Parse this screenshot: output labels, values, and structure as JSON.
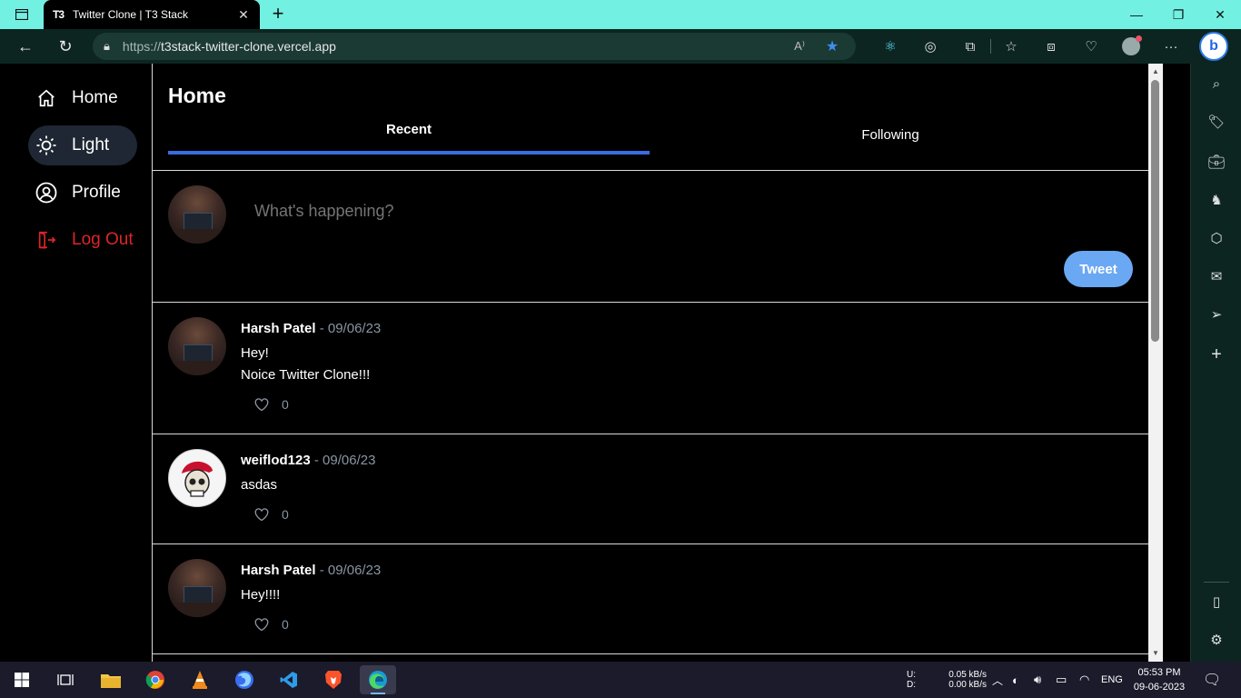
{
  "browser": {
    "tab_favicon": "T3",
    "tab_title": "Twitter Clone | T3 Stack",
    "url_prefix": "https://",
    "url_host": "t3stack-twitter-clone.vercel.app"
  },
  "nav": {
    "items": [
      {
        "label": "Home",
        "icon": "home-icon"
      },
      {
        "label": "Light",
        "icon": "sun-icon"
      },
      {
        "label": "Profile",
        "icon": "user-circle-icon"
      },
      {
        "label": "Log Out",
        "icon": "logout-icon"
      }
    ]
  },
  "main": {
    "title": "Home",
    "tabs": [
      {
        "label": "Recent",
        "active": true
      },
      {
        "label": "Following",
        "active": false
      }
    ],
    "compose": {
      "placeholder": "What's happening?",
      "button": "Tweet"
    },
    "posts": [
      {
        "author": "Harsh Patel",
        "date": " - 09/06/23",
        "lines": [
          "Hey!",
          "Noice Twitter Clone!!!"
        ],
        "likes": "0",
        "avatar": "desk"
      },
      {
        "author": "weiflod123",
        "date": " - 09/06/23",
        "lines": [
          "asdas"
        ],
        "likes": "0",
        "avatar": "skull"
      },
      {
        "author": "Harsh Patel",
        "date": " - 09/06/23",
        "lines": [
          "Hey!!!!"
        ],
        "likes": "0",
        "avatar": "desk"
      }
    ]
  },
  "taskbar": {
    "net_up_label": "U:",
    "net_down_label": "D:",
    "net_up": "0.05 kB/s",
    "net_down": "0.00 kB/s",
    "lang": "ENG",
    "time": "05:53 PM",
    "date": "09-06-2023"
  },
  "colors": {
    "accent": "#3b6be0",
    "tweet_button": "#6aa8f3",
    "logout": "#dc2626",
    "titlebar": "#72f0e2"
  }
}
